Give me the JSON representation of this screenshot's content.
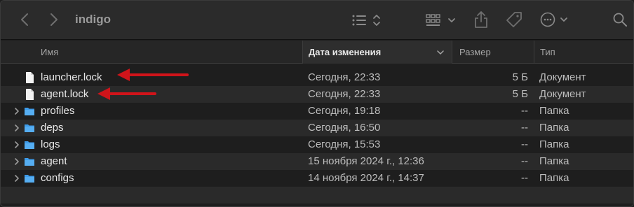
{
  "window": {
    "title": "indigo"
  },
  "toolbar": {
    "back_icon": "chevron-left-icon",
    "forward_icon": "chevron-right-icon",
    "view_list_icon": "list-view-icon",
    "view_grid_icon": "grid-view-icon",
    "share_icon": "share-icon",
    "tag_icon": "tag-icon",
    "more_icon": "ellipsis-circle-icon",
    "search_icon": "search-icon"
  },
  "columns": {
    "name": "Имя",
    "date": "Дата изменения",
    "size": "Размер",
    "type": "Тип"
  },
  "files": [
    {
      "name": "launcher.lock",
      "date": "Сегодня, 22:33",
      "size": "5 Б",
      "type": "Документ",
      "kind": "document"
    },
    {
      "name": "agent.lock",
      "date": "Сегодня, 22:33",
      "size": "5 Б",
      "type": "Документ",
      "kind": "document"
    },
    {
      "name": "profiles",
      "date": "Сегодня, 19:18",
      "size": "--",
      "type": "Папка",
      "kind": "folder"
    },
    {
      "name": "deps",
      "date": "Сегодня, 16:50",
      "size": "--",
      "type": "Папка",
      "kind": "folder"
    },
    {
      "name": "logs",
      "date": "Сегодня, 15:53",
      "size": "--",
      "type": "Папка",
      "kind": "folder"
    },
    {
      "name": "agent",
      "date": "15 ноября 2024 г., 12:36",
      "size": "--",
      "type": "Папка",
      "kind": "folder"
    },
    {
      "name": "configs",
      "date": "14 ноября 2024 г., 14:37",
      "size": "--",
      "type": "Папка",
      "kind": "folder"
    }
  ],
  "colors": {
    "folder": "#3d9be9",
    "annotation_arrow": "#d0141a",
    "background": "#1e1e1e"
  }
}
